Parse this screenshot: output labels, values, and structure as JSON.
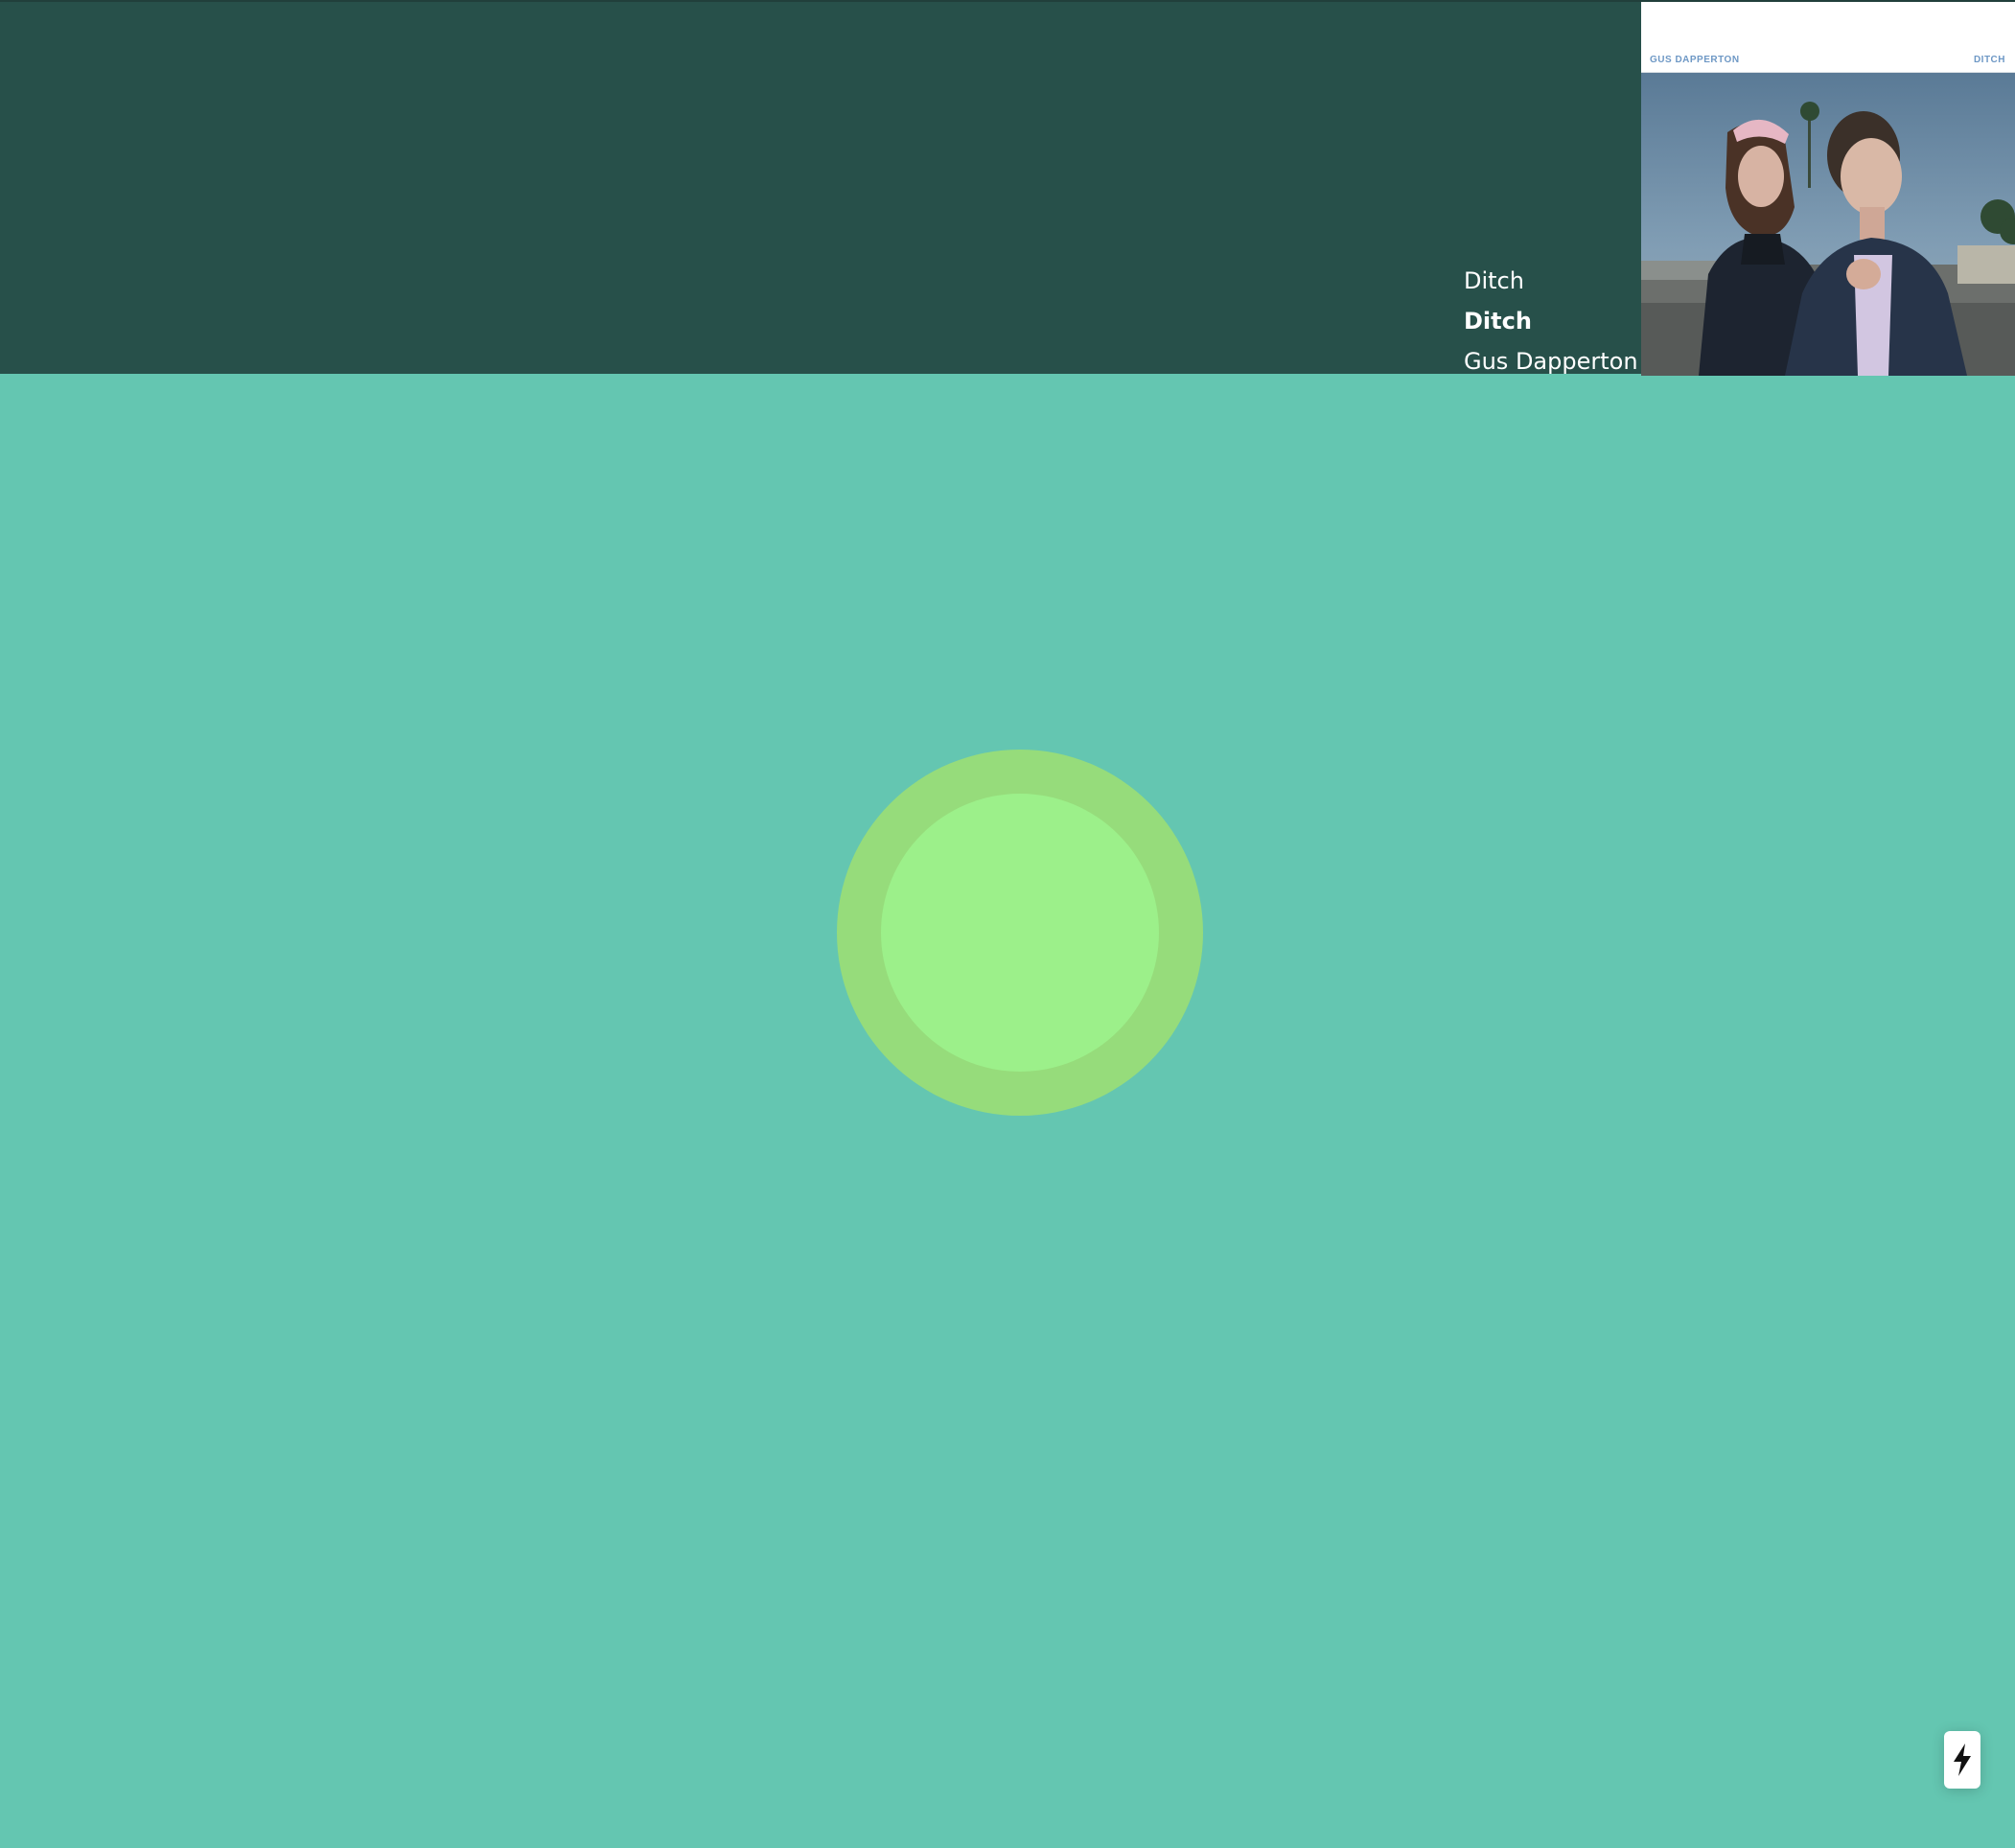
{
  "now_playing": {
    "album": "Ditch",
    "track": "Ditch",
    "artist": "Gus Dapperton"
  },
  "cover_art": {
    "artist_text": "GUS DAPPERTON",
    "title_text": "DITCH"
  },
  "colors": {
    "header_background": "#27504a",
    "page_background": "#64c6b1",
    "outer_circle": "#96dc7b",
    "inner_circle": "#9cf08a",
    "cover_text": "#6e98c5"
  },
  "action_button": {
    "icon": "lightning-bolt-icon"
  }
}
